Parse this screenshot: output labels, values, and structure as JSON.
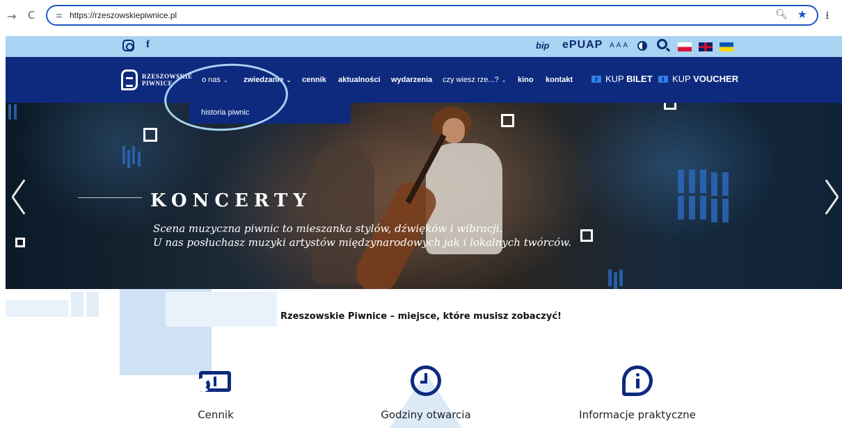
{
  "browser": {
    "back_icon": "→",
    "reload_icon": "C",
    "site_info_icon": "⚙",
    "url": "https://rzeszowskiepiwnice.pl",
    "zoom_icon": "⊕",
    "star_icon": "★",
    "download_icon": "⤓"
  },
  "utility_bar": {
    "facebook": "f",
    "bip": "bip",
    "epuap": "ePUAP",
    "font_size": "AAA",
    "colors": {
      "background": "#a9d3f3",
      "icon": "#0d2a6e"
    }
  },
  "nav": {
    "logo_line1": "RZESZOWSKIE",
    "logo_line2": "PIWNICE",
    "items": [
      {
        "label": "o nas",
        "has_caret": true
      },
      {
        "label": "zwiedzanie",
        "has_caret": true
      },
      {
        "label": "cennik"
      },
      {
        "label": "aktualności"
      },
      {
        "label": "wydarzenia"
      },
      {
        "label": "czy wiesz rze...?",
        "has_caret": true
      },
      {
        "label": "kino"
      },
      {
        "label": "kontakt"
      }
    ],
    "caret": "⌄",
    "cta_bilet_prefix": "KUP ",
    "cta_bilet_bold": "BILET",
    "cta_voucher_prefix": "KUP ",
    "cta_voucher_bold": "VOUCHER",
    "colors": {
      "background": "#0d2a7e",
      "accent": "#2e7fe8"
    }
  },
  "dropdown": {
    "items": [
      "historia piwnic"
    ]
  },
  "hero": {
    "title": "KONCERTY",
    "subtitle_line1": "Scena muzyczna piwnic to mieszanka stylów, dźwięków i wibracji.",
    "subtitle_line2": "U nas posłuchasz muzyki artystów międzynarodowych jak i lokalnych twórców."
  },
  "tagline": "Rzeszowskie Piwnice – miejsce, które musisz zobaczyć!",
  "info_items": [
    {
      "label": "Cennik",
      "icon": "ticket-icon"
    },
    {
      "label": "Godziny otwarcia",
      "icon": "clock-icon"
    },
    {
      "label": "Informacje praktyczne",
      "icon": "info-icon"
    }
  ]
}
